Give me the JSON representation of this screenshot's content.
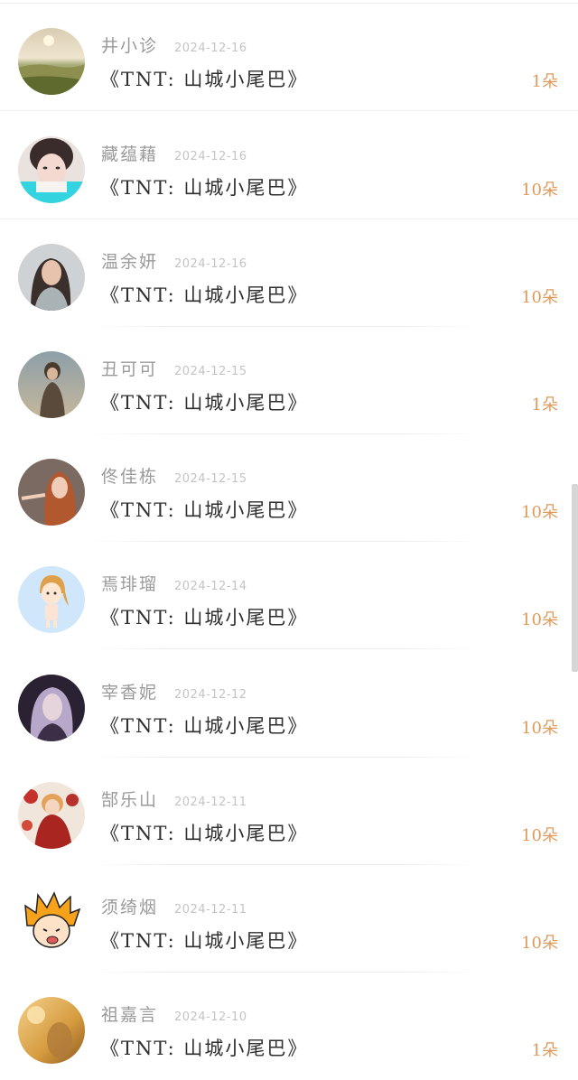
{
  "records": [
    {
      "name": "井小诊",
      "date": "2024-12-16",
      "gift": "《TNT: 山城小尾巴》",
      "count": "1朵",
      "avatar": "landscape-sunset-avatar"
    },
    {
      "name": "藏蕴藉",
      "date": "2024-12-16",
      "gift": "《TNT: 山城小尾巴》",
      "count": "10朵",
      "avatar": "boy-portrait-avatar"
    },
    {
      "name": "温余妍",
      "date": "2024-12-16",
      "gift": "《TNT: 山城小尾巴》",
      "count": "10朵",
      "avatar": "woman-portrait-avatar"
    },
    {
      "name": "丑可可",
      "date": "2024-12-15",
      "gift": "《TNT: 山城小尾巴》",
      "count": "1朵",
      "avatar": "girl-sky-avatar"
    },
    {
      "name": "佟佳栋",
      "date": "2024-12-15",
      "gift": "《TNT: 山城小尾巴》",
      "count": "10朵",
      "avatar": "redhead-woman-avatar"
    },
    {
      "name": "焉琲瑠",
      "date": "2024-12-14",
      "gift": "《TNT: 山城小尾巴》",
      "count": "10朵",
      "avatar": "cartoon-girl-avatar"
    },
    {
      "name": "宰香妮",
      "date": "2024-12-12",
      "gift": "《TNT: 山城小尾巴》",
      "count": "10朵",
      "avatar": "purple-hair-avatar"
    },
    {
      "name": "郜乐山",
      "date": "2024-12-11",
      "gift": "《TNT: 山城小尾巴》",
      "count": "10朵",
      "avatar": "anime-red-avatar"
    },
    {
      "name": "须绮烟",
      "date": "2024-12-11",
      "gift": "《TNT: 山城小尾巴》",
      "count": "10朵",
      "avatar": "orange-anime-avatar"
    },
    {
      "name": "祖嘉言",
      "date": "2024-12-10",
      "gift": "《TNT: 山城小尾巴》",
      "count": "1朵",
      "avatar": "golden-autumn-avatar"
    }
  ],
  "colors": {
    "name": "#9a9a9a",
    "date": "#c4c4c4",
    "gift": "#2f2f2f",
    "count": "#e09a5c"
  }
}
